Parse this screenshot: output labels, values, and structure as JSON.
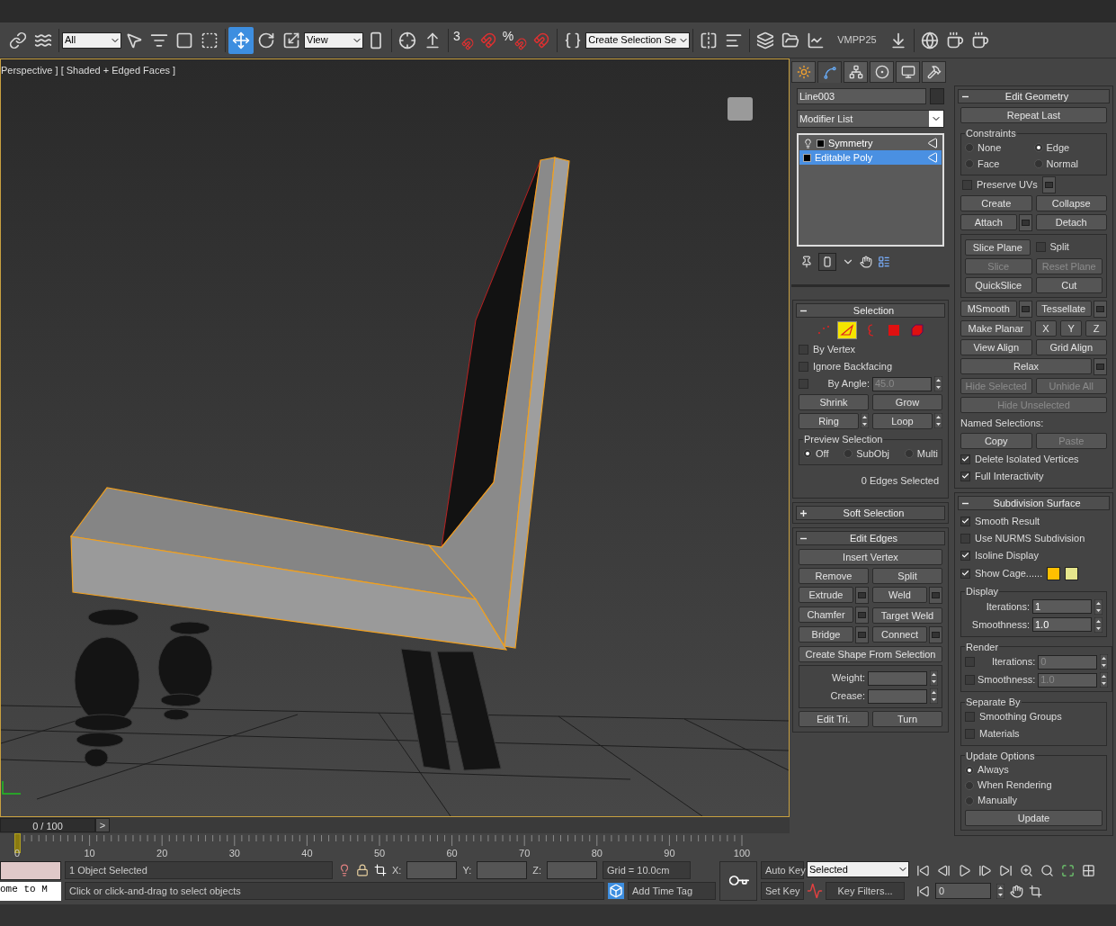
{
  "toolbar": {
    "selection_filter": "All",
    "transform_tools": [
      {
        "kind": "move",
        "selected": true
      },
      {
        "kind": "rotate",
        "selected": false
      },
      {
        "kind": "scale",
        "selected": false
      }
    ],
    "coordinate_system": "View",
    "snap_label": "3",
    "percent_snap_label": "%",
    "named_selection_set": "Create Selection Se",
    "viewport_preset": "VMPP25"
  },
  "viewport": {
    "label": "Perspective ] [ Shaded + Edged Faces ]"
  },
  "command_panel": {
    "tabs": [
      {
        "kind": "create",
        "selected": false
      },
      {
        "kind": "modify",
        "selected": true
      },
      {
        "kind": "hierarchy",
        "selected": false
      },
      {
        "kind": "motion",
        "selected": false
      },
      {
        "kind": "display",
        "selected": false
      },
      {
        "kind": "utilities",
        "selected": false
      }
    ],
    "object_name": "Line003",
    "modifier_list": "Modifier List",
    "stack": [
      {
        "kind": "modifier",
        "label": "Symmetry",
        "selected": false
      },
      {
        "kind": "base",
        "label": "Editable Poly",
        "selected": true
      }
    ]
  },
  "left_rollouts": [
    {
      "title": "Selection",
      "expanded": true,
      "items": [
        {
          "kind": "subobjects",
          "modes": [
            {
              "kind": "vertex",
              "selected": false
            },
            {
              "kind": "edge",
              "selected": true
            },
            {
              "kind": "border",
              "selected": false
            },
            {
              "kind": "polygon",
              "selected": false
            },
            {
              "kind": "element",
              "selected": false
            }
          ]
        },
        {
          "kind": "checkbox",
          "label": "By Vertex",
          "checked": false
        },
        {
          "kind": "checkbox",
          "label": "Ignore Backfacing",
          "checked": false
        },
        {
          "kind": "spinner",
          "label": "By Angle:",
          "value": "45.0",
          "checked": false,
          "disabled": true
        },
        {
          "kind": "buttons",
          "buttons": [
            {
              "kind": "button",
              "label": "Shrink",
              "disabled": false
            },
            {
              "kind": "button",
              "label": "Grow",
              "disabled": false
            }
          ]
        },
        {
          "kind": "buttons",
          "buttons": [
            {
              "kind": "button",
              "label": "Ring",
              "disabled": false,
              "arrows": true
            },
            {
              "kind": "button",
              "label": "Loop",
              "disabled": false,
              "arrows": true
            }
          ]
        },
        {
          "kind": "group",
          "title": "Preview Selection",
          "items": [
            {
              "kind": "radio_row",
              "options": [
                {
                  "label": "Off",
                  "selected": true
                },
                {
                  "label": "SubObj",
                  "selected": false
                },
                {
                  "label": "Multi",
                  "selected": false
                }
              ]
            }
          ]
        },
        {
          "kind": "text",
          "text": "0 Edges Selected"
        }
      ]
    },
    {
      "title": "Soft Selection",
      "expanded": false
    },
    {
      "title": "Edit Edges",
      "expanded": true,
      "items": [
        {
          "kind": "buttons",
          "buttons": [
            {
              "kind": "button",
              "label": "Insert Vertex",
              "disabled": false
            }
          ]
        },
        {
          "kind": "buttons",
          "buttons": [
            {
              "kind": "button",
              "label": "Remove",
              "disabled": false
            },
            {
              "kind": "button",
              "label": "Split",
              "disabled": false
            }
          ]
        },
        {
          "kind": "buttons",
          "buttons": [
            {
              "kind": "button",
              "label": "Extrude",
              "disabled": false,
              "settings": true
            },
            {
              "kind": "button",
              "label": "Weld",
              "disabled": false,
              "settings": true
            }
          ]
        },
        {
          "kind": "buttons",
          "buttons": [
            {
              "kind": "button",
              "label": "Chamfer",
              "disabled": false,
              "settings": true
            },
            {
              "kind": "button",
              "label": "Target Weld",
              "disabled": false
            }
          ]
        },
        {
          "kind": "buttons",
          "buttons": [
            {
              "kind": "button",
              "label": "Bridge",
              "disabled": false,
              "settings": true
            },
            {
              "kind": "button",
              "label": "Connect",
              "disabled": false,
              "settings": true
            }
          ]
        },
        {
          "kind": "buttons",
          "buttons": [
            {
              "kind": "button",
              "label": "Create Shape From Selection",
              "disabled": false
            }
          ]
        },
        {
          "kind": "group",
          "items": [
            {
              "kind": "spinner",
              "label": "Weight:",
              "disabled": false
            },
            {
              "kind": "spinner",
              "label": "Crease:",
              "disabled": false
            }
          ]
        },
        {
          "kind": "buttons",
          "buttons": [
            {
              "kind": "button",
              "label": "Edit Tri.",
              "disabled": false
            },
            {
              "kind": "button",
              "label": "Turn",
              "disabled": false
            }
          ]
        }
      ]
    }
  ],
  "right_rollouts": [
    {
      "title": "Edit Geometry",
      "expanded": true,
      "items": [
        {
          "kind": "buttons",
          "buttons": [
            {
              "kind": "button",
              "label": "Repeat Last",
              "disabled": false
            }
          ]
        },
        {
          "kind": "group",
          "title": "Constraints",
          "items": [
            {
              "kind": "radio_grid",
              "options": [
                {
                  "label": "None",
                  "selected": false
                },
                {
                  "label": "Edge",
                  "selected": true
                },
                {
                  "label": "Face",
                  "selected": false
                },
                {
                  "label": "Normal",
                  "selected": false
                }
              ]
            }
          ]
        },
        {
          "kind": "buttons",
          "buttons": [
            {
              "kind": "checkbox",
              "label": "Preserve UVs",
              "checked": false,
              "settings": true
            }
          ]
        },
        {
          "kind": "buttons",
          "buttons": [
            {
              "kind": "button",
              "label": "Create",
              "disabled": false
            },
            {
              "kind": "button",
              "label": "Collapse",
              "disabled": false
            }
          ]
        },
        {
          "kind": "buttons",
          "buttons": [
            {
              "kind": "button",
              "label": "Attach",
              "disabled": false,
              "settings": true
            },
            {
              "kind": "button",
              "label": "Detach",
              "disabled": false
            }
          ]
        },
        {
          "kind": "group",
          "items": [
            {
              "kind": "buttons",
              "buttons": [
                {
                  "kind": "button",
                  "label": "Slice Plane",
                  "disabled": false
                },
                {
                  "kind": "checkbox",
                  "label": "Split",
                  "checked": false
                }
              ]
            },
            {
              "kind": "buttons",
              "buttons": [
                {
                  "kind": "button",
                  "label": "Slice",
                  "disabled": true
                },
                {
                  "kind": "button",
                  "label": "Reset Plane",
                  "disabled": true
                }
              ]
            },
            {
              "kind": "buttons",
              "buttons": [
                {
                  "kind": "button",
                  "label": "QuickSlice",
                  "disabled": false
                },
                {
                  "kind": "button",
                  "label": "Cut",
                  "disabled": false
                }
              ]
            }
          ]
        },
        {
          "kind": "buttons",
          "buttons": [
            {
              "kind": "button",
              "label": "MSmooth",
              "disabled": false,
              "settings": true
            },
            {
              "kind": "button",
              "label": "Tessellate",
              "disabled": false,
              "settings": true
            }
          ]
        },
        {
          "kind": "buttons",
          "buttons": [
            {
              "kind": "button",
              "label": "Make Planar",
              "disabled": false
            },
            {
              "kind": "button",
              "label": "X",
              "disabled": false
            },
            {
              "kind": "button",
              "label": "Y",
              "disabled": false
            },
            {
              "kind": "button",
              "label": "Z",
              "disabled": false
            }
          ]
        },
        {
          "kind": "buttons",
          "buttons": [
            {
              "kind": "button",
              "label": "View Align",
              "disabled": false
            },
            {
              "kind": "button",
              "label": "Grid Align",
              "disabled": false
            }
          ]
        },
        {
          "kind": "buttons",
          "buttons": [
            {
              "kind": "button",
              "label": "Relax",
              "disabled": false,
              "settings": true
            }
          ]
        },
        {
          "kind": "buttons",
          "buttons": [
            {
              "kind": "button",
              "label": "Hide Selected",
              "disabled": true
            },
            {
              "kind": "button",
              "label": "Unhide All",
              "disabled": true
            }
          ]
        },
        {
          "kind": "buttons",
          "buttons": [
            {
              "kind": "button",
              "label": "Hide Unselected",
              "disabled": true
            }
          ]
        },
        {
          "kind": "label",
          "text": "Named Selections:"
        },
        {
          "kind": "buttons",
          "buttons": [
            {
              "kind": "button",
              "label": "Copy",
              "disabled": false
            },
            {
              "kind": "button",
              "label": "Paste",
              "disabled": true
            }
          ]
        },
        {
          "kind": "checkbox",
          "label": "Delete Isolated Vertices",
          "checked": true
        },
        {
          "kind": "checkbox",
          "label": "Full Interactivity",
          "checked": true
        }
      ]
    },
    {
      "title": "Subdivision Surface",
      "expanded": true,
      "items": [
        {
          "kind": "checkbox",
          "label": "Smooth Result",
          "checked": true
        },
        {
          "kind": "checkbox",
          "label": "Use NURMS Subdivision",
          "checked": false
        },
        {
          "kind": "checkbox",
          "label": "Isoline Display",
          "checked": true
        },
        {
          "kind": "cage",
          "label": "Show Cage......",
          "checked": true,
          "swatches": [
            {
              "color": "#ffc000"
            },
            {
              "color": "#e6e68c"
            }
          ]
        },
        {
          "kind": "group",
          "title": "Display",
          "items": [
            {
              "kind": "spinner",
              "label": "Iterations:",
              "value": "1",
              "disabled": false
            },
            {
              "kind": "spinner",
              "label": "Smoothness:",
              "value": "1.0",
              "disabled": false
            }
          ]
        },
        {
          "kind": "group",
          "title": "Render",
          "items": [
            {
              "kind": "spinner",
              "label": "Iterations:",
              "value": "0",
              "checked": false,
              "disabled": true
            },
            {
              "kind": "spinner",
              "label": "Smoothness:",
              "value": "1.0",
              "checked": false,
              "disabled": true
            }
          ]
        },
        {
          "kind": "group",
          "title": "Separate By",
          "items": [
            {
              "kind": "checkbox",
              "label": "Smoothing Groups",
              "checked": false
            },
            {
              "kind": "checkbox",
              "label": "Materials",
              "checked": false
            }
          ]
        },
        {
          "kind": "group",
          "title": "Update Options",
          "items": [
            {
              "kind": "radio_list",
              "options": [
                {
                  "label": "Always",
                  "selected": true
                },
                {
                  "label": "When Rendering",
                  "selected": false
                },
                {
                  "label": "Manually",
                  "selected": false
                }
              ]
            },
            {
              "kind": "buttons",
              "buttons": [
                {
                  "kind": "button",
                  "label": "Update",
                  "disabled": false
                }
              ]
            }
          ]
        }
      ]
    }
  ],
  "timeline": {
    "frame_readout": "0 / 100",
    "next_button": ">",
    "ruler_labels": [
      "0",
      "10",
      "20",
      "30",
      "40",
      "50",
      "60",
      "70",
      "80",
      "90",
      "100"
    ]
  },
  "status_bar": {
    "listener_output": "ome to M",
    "selection_info": "1 Object Selected",
    "prompt": "Click or click-and-drag to select objects",
    "x_label": "X:",
    "y_label": "Y:",
    "z_label": "Z:",
    "grid": "Grid = 10.0cm",
    "add_time_tag": "Add Time Tag",
    "auto_key": "Auto Key",
    "set_key": "Set Key",
    "key_mode": "Selected",
    "key_filters": "Key Filters...",
    "current_frame": "0"
  }
}
